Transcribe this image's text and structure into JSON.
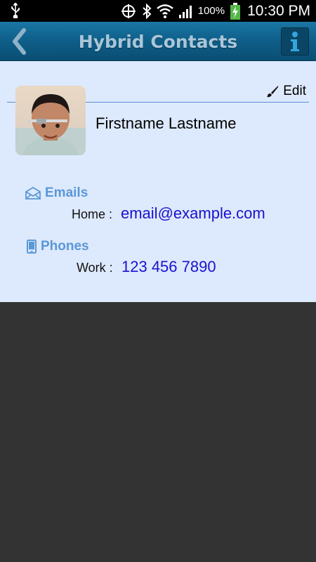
{
  "status_bar": {
    "battery_pct": "100%",
    "time": "10:30 PM"
  },
  "header": {
    "title": "Hybrid Contacts",
    "back_icon": "chevron-left-icon",
    "info_icon": "info-icon"
  },
  "contact": {
    "edit_label": "Edit",
    "name": "Firstname Lastname",
    "emails_heading": "Emails",
    "email": {
      "label": "Home :",
      "value": "email@example.com"
    },
    "phones_heading": "Phones",
    "phone": {
      "label": "Work :",
      "value": "123 456 7890"
    }
  },
  "colors": {
    "header": "#0e5e88",
    "panel": "#dde9fc",
    "heading": "#5a98d8",
    "link": "#1a12d0",
    "background": "#333333"
  }
}
